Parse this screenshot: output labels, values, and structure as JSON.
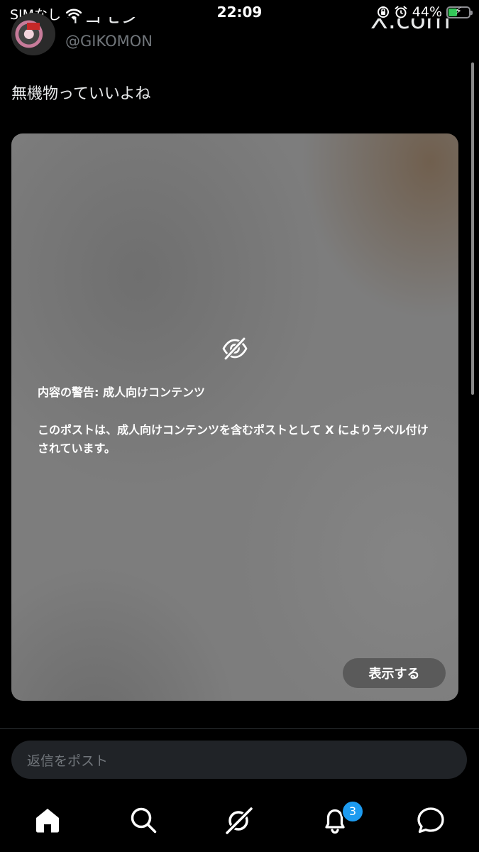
{
  "status_bar": {
    "carrier": "SIMなし",
    "time": "22:09",
    "battery_percent": "44%",
    "battery_level": 0.44,
    "icons": [
      "wifi-icon",
      "rotation-lock-icon",
      "alarm-icon",
      "battery-icon"
    ]
  },
  "post": {
    "display_name": "イコモン",
    "handle": "@GIKOMON",
    "site_label": "X.com",
    "text": "無機物っていいよね",
    "media": {
      "warning_title": "内容の警告: 成人向けコンテンツ",
      "warning_body": "このポストは、成人向けコンテンツを含むポストとして X によりラベル付けされています。",
      "show_button_label": "表示する",
      "icon": "eye-slash-icon"
    }
  },
  "reply": {
    "placeholder": "返信をポスト"
  },
  "bottom_nav": {
    "items": [
      "home-icon",
      "search-icon",
      "grok-icon",
      "notifications-icon",
      "messages-icon"
    ],
    "notification_badge": "3"
  },
  "colors": {
    "background": "#000000",
    "text_primary": "#e7e9ea",
    "text_secondary": "#71767b",
    "accent": "#1d9bf0",
    "battery_green": "#34c759"
  }
}
